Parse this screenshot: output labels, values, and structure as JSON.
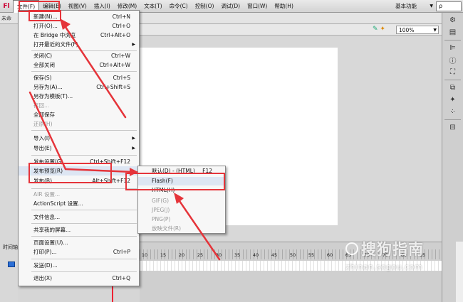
{
  "menubar": {
    "logo": "Fl",
    "items": [
      "文件(F)",
      "编辑(E)",
      "视图(V)",
      "插入(I)",
      "修改(M)",
      "文本(T)",
      "命令(C)",
      "控制(O)",
      "调试(D)",
      "窗口(W)",
      "帮助(H)"
    ],
    "workspace": "基本功能",
    "search": "ρ"
  },
  "toolbar2": {
    "tab_partial": "未命"
  },
  "editbar": {
    "zoom": "100%"
  },
  "timeline": {
    "label": "时间轴",
    "ticks": [
      "10",
      "15",
      "20",
      "25",
      "30",
      "35",
      "40",
      "45",
      "50",
      "55",
      "60",
      "65",
      "70",
      "75",
      "80",
      "85"
    ]
  },
  "file_menu": {
    "items": [
      {
        "label": "新建(N)...",
        "shortcut": "Ctrl+N",
        "disabled": false
      },
      {
        "label": "打开(O)...",
        "shortcut": "Ctrl+O",
        "disabled": false
      },
      {
        "label": "在 Bridge 中浏览",
        "shortcut": "Ctrl+Alt+O",
        "disabled": false
      },
      {
        "label": "打开最近的文件(F)",
        "shortcut": "",
        "disabled": false,
        "submenu": true
      },
      {
        "label": "关闭(C)",
        "shortcut": "Ctrl+W",
        "disabled": false
      },
      {
        "label": "全部关闭",
        "shortcut": "Ctrl+Alt+W",
        "disabled": false
      },
      {
        "label": "保存(S)",
        "shortcut": "Ctrl+S",
        "disabled": false
      },
      {
        "label": "另存为(A)...",
        "shortcut": "Ctrl+Shift+S",
        "disabled": false
      },
      {
        "label": "另存为模板(T)...",
        "shortcut": "",
        "disabled": false
      },
      {
        "label": "存回...",
        "shortcut": "",
        "disabled": true
      },
      {
        "label": "全部保存",
        "shortcut": "",
        "disabled": false
      },
      {
        "label": "还原(H)",
        "shortcut": "",
        "disabled": true
      },
      {
        "label": "导入(I)",
        "shortcut": "",
        "disabled": false,
        "submenu": true
      },
      {
        "label": "导出(E)",
        "shortcut": "",
        "disabled": false,
        "submenu": true
      },
      {
        "label": "发布设置(G)...",
        "shortcut": "Ctrl+Shift+F12",
        "disabled": false
      },
      {
        "label": "发布预览(R)",
        "shortcut": "",
        "disabled": false,
        "submenu": true,
        "highlighted": true
      },
      {
        "label": "发布(B)",
        "shortcut": "Alt+Shift+F12",
        "disabled": false
      },
      {
        "label": "AIR 设置...",
        "shortcut": "",
        "disabled": true
      },
      {
        "label": "ActionScript 设置...",
        "shortcut": "",
        "disabled": false
      },
      {
        "label": "文件信息...",
        "shortcut": "",
        "disabled": false
      },
      {
        "label": "共享我的屏幕...",
        "shortcut": "",
        "disabled": false
      },
      {
        "label": "页面设置(U)...",
        "shortcut": "",
        "disabled": false
      },
      {
        "label": "打印(P)...",
        "shortcut": "Ctrl+P",
        "disabled": false
      },
      {
        "label": "发送(D)...",
        "shortcut": "",
        "disabled": false
      },
      {
        "label": "退出(X)",
        "shortcut": "Ctrl+Q",
        "disabled": false
      }
    ]
  },
  "publish_preview_submenu": {
    "items": [
      {
        "label": "默认(D) - (HTML)",
        "shortcut": "F12",
        "disabled": false
      },
      {
        "label": "Flash(F)",
        "shortcut": "",
        "disabled": false,
        "highlighted": true
      },
      {
        "label": "HTML(H)",
        "shortcut": "",
        "disabled": false
      },
      {
        "label": "GIF(G)",
        "shortcut": "",
        "disabled": true
      },
      {
        "label": "JPEG(J)",
        "shortcut": "",
        "disabled": true
      },
      {
        "label": "PNG(P)",
        "shortcut": "",
        "disabled": true
      },
      {
        "label": "放映文件(R)",
        "shortcut": "",
        "disabled": true
      }
    ]
  },
  "watermark": {
    "title": "搜狗指南",
    "url": "zhinan.sogou.com"
  },
  "colors": {
    "annotation": "#e5343a",
    "highlight": "#dde6f3",
    "stage": "#ffffff"
  }
}
